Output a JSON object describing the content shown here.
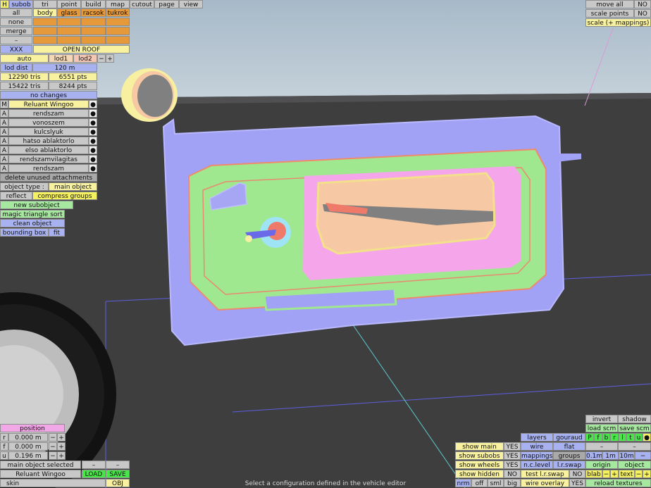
{
  "top_menu": {
    "h": "H",
    "subob": "subob",
    "tri": "tri",
    "point": "point",
    "build": "build",
    "map": "map",
    "cutout": "cutout",
    "page": "page",
    "view": "view"
  },
  "left": {
    "all": "all",
    "none": "none",
    "merge": "merge",
    "dash": "–",
    "xxx": "XXX",
    "open_roof": "OPEN ROOF",
    "cols": [
      "body",
      "glass",
      "racsok",
      "tukrok"
    ],
    "auto": "auto",
    "lod1": "lod1",
    "lod2": "lod2",
    "minus": "−",
    "plus": "+",
    "lod_dist": "lod dist",
    "lod_val": "120 m",
    "tris1": "12290 tris",
    "pts1": "6551 pts",
    "tris2": "15422 tris",
    "pts2": "8244 pts",
    "no_changes": "no changes",
    "m": "M",
    "reluant": "Reluant Wingoo",
    "dot": "●",
    "a": "A",
    "attachments": [
      "rendszam",
      "vonoszem",
      "kulcslyuk",
      "hatso ablaktorlo",
      "elso ablaktorlo",
      "rendszamvilagitas",
      "rendszam"
    ],
    "delete_unused": "delete unused attachments",
    "object_type": "object type :",
    "main_object": "main object",
    "reflect": "reflect",
    "compress_groups": "compress groups",
    "new_subobject": "new subobject",
    "magic_sort": "magic triangle sort",
    "clean_object": "clean object",
    "bounding_box": "bounding box",
    "fit": "fit"
  },
  "top_right": {
    "move_all": "move all",
    "no": "NO",
    "scale_points": "scale points",
    "scale_mappings": "scale (+ mappings)"
  },
  "position": {
    "title": "position",
    "r": "r",
    "f": "f",
    "u": "u",
    "r_val": "0.000 m",
    "f_val": "0.000 m",
    "u_val": "0.196 m",
    "main_selected": "main object selected",
    "name": "Reluant Wingoo",
    "load": "LOAD",
    "save": "SAVE",
    "skin": "skin",
    "obj": "OBJ"
  },
  "show": {
    "main": "show main",
    "subobs": "show subobs",
    "wheels": "show wheels",
    "hidden": "show hidden",
    "yes": "YES",
    "no": "NO",
    "nrm": "nrm",
    "off": "off",
    "sml": "sml",
    "big": "big"
  },
  "layers": {
    "layers": "layers",
    "gouraud": "gouraud",
    "wire": "wire",
    "flat": "flat",
    "mappings": "mappings",
    "groups": "groups",
    "nclevel": "n.c.level",
    "lrswap": "l.r.swap",
    "test_lrswap": "test l.r.swap",
    "no": "NO",
    "wire_overlay": "wire overlay",
    "yes": "YES"
  },
  "right_panel": {
    "invert": "invert",
    "shadow": "shadow",
    "load_scm": "load scm",
    "save_scm": "save scm",
    "flags": [
      "P",
      "f",
      "b",
      "r",
      "l",
      "t",
      "u"
    ],
    "dot": "●",
    "d1": "0.1m",
    "d2": "1m",
    "d3": "10m",
    "origin": "origin",
    "object": "object",
    "blab": "blab",
    "text": "text",
    "reload_textures": "reload textures"
  },
  "status": "Select a configuration defined in the vehicle editor"
}
